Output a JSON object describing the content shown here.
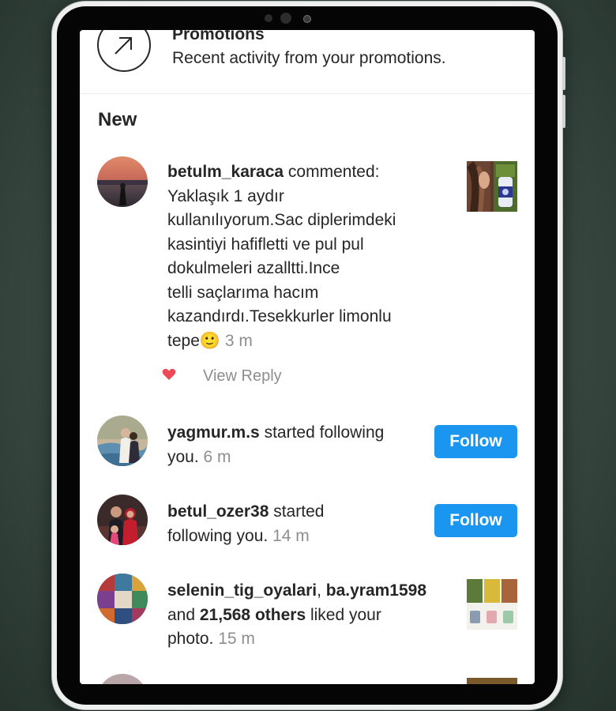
{
  "promotions": {
    "title": "Promotions",
    "subtitle": "Recent activity from your promotions.",
    "icon": "arrow-up-right-icon"
  },
  "section_title": "New",
  "notifications": [
    {
      "username": "betulm_karaca",
      "action": " commented:",
      "lines": [
        "Yaklaşık 1 aydır",
        "kullanılıyorum.Sac diplerimdeki",
        "kasintiyi hafifletti ve pul pul",
        "dokulmeleri azalltti.Ince",
        "telli saçlarıma hacım",
        "kazandırdı.Tesekkurler limonlu",
        "tepe"
      ],
      "emoji": "🙂",
      "time": "3 m",
      "view_reply": "View Reply",
      "liked_icon": "heart-icon",
      "heart_color": "#ed4956"
    },
    {
      "username": "yagmur.m.s",
      "line1_rest": " started following",
      "line2": "you.",
      "time": "6 m",
      "button": "Follow"
    },
    {
      "username": "betul_ozer38",
      "line1_rest": " started",
      "line2": "following you.",
      "time": "14 m",
      "button": "Follow"
    },
    {
      "username1": "selenin_tig_oyalari",
      "sep": ", ",
      "username2": "ba.yram1598",
      "and": "and ",
      "others": "21,568 others",
      "liked": " liked your",
      "line3": "photo.",
      "time": "15 m"
    }
  ],
  "colors": {
    "follow_button": "#1a96f0",
    "text": "#262626",
    "secondary_text": "#8e8e8e"
  }
}
